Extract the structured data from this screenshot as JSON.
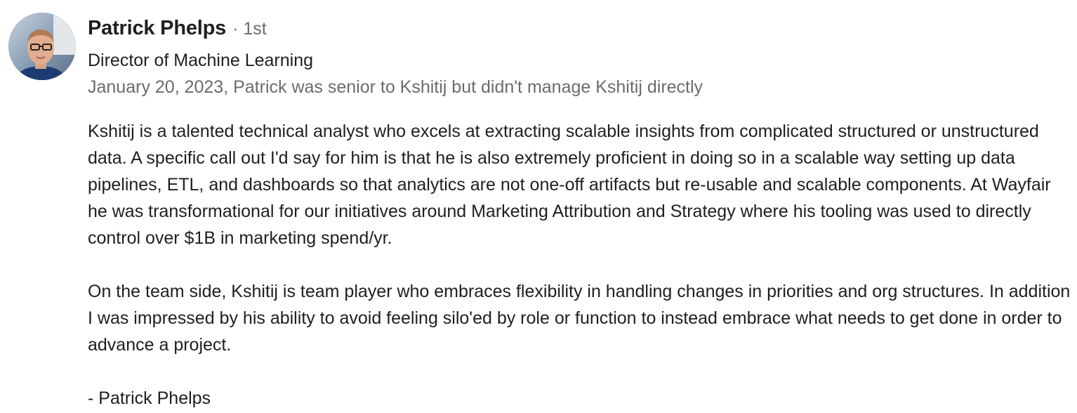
{
  "recommender": {
    "name": "Patrick Phelps",
    "degree": "· 1st",
    "headline": "Director of Machine Learning",
    "meta": "January 20, 2023, Patrick was senior to Kshitij but didn't manage Kshitij directly",
    "avatar_icon": "profile-photo"
  },
  "recommendation": {
    "paragraphs": [
      "Kshitij is a talented technical analyst who excels at extracting scalable insights from complicated structured or unstructured data. A specific call out I'd say for him is that he is also extremely proficient in doing so in a scalable way setting up data pipelines, ETL, and dashboards so that analytics are not one-off artifacts but re-usable and scalable components. At Wayfair he was transformational for our initiatives around Marketing Attribution and Strategy where his tooling was used to directly control over $1B in marketing spend/yr.",
      "On the team side, Kshitij is team player who embraces flexibility in handling changes in priorities and org structures. In addition I was impressed by his ability to avoid feeling silo'ed by role or function to instead embrace what needs to get done in order to advance a project."
    ],
    "signature": "- Patrick Phelps"
  },
  "colors": {
    "primary_text": "#1f1f1f",
    "secondary_text": "#6b6b6b",
    "background": "#ffffff"
  }
}
